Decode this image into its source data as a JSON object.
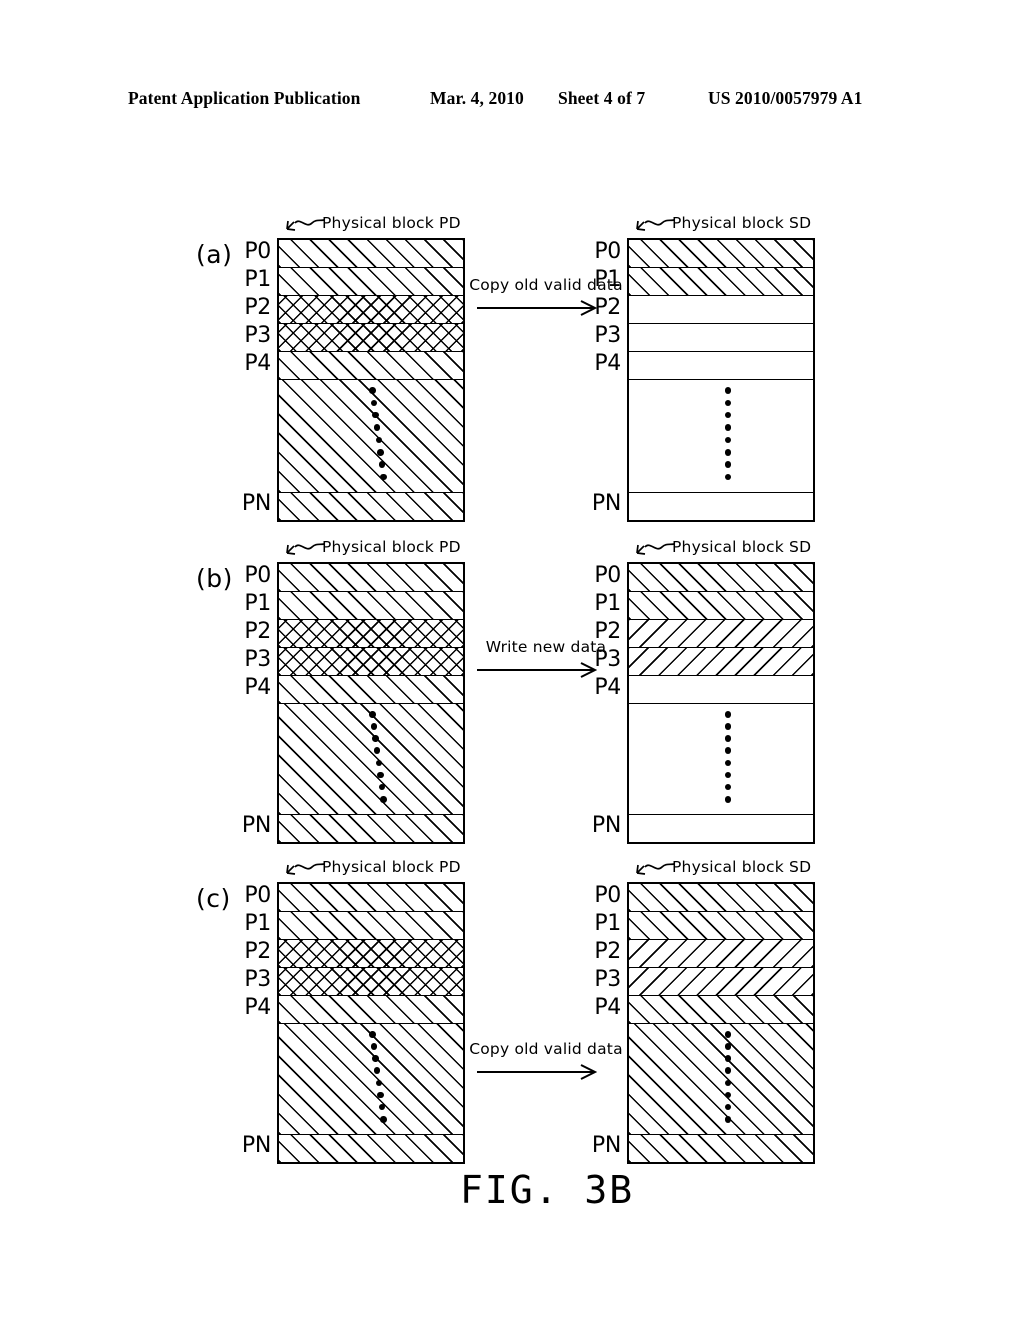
{
  "header": {
    "publication": "Patent Application Publication",
    "date": "Mar. 4, 2010",
    "sheet": "Sheet 4 of 7",
    "number": "US 2010/0057979 A1"
  },
  "figure": {
    "caption": "FIG. 3B",
    "row_labels": [
      "P0",
      "P1",
      "P2",
      "P3",
      "P4",
      "PN"
    ],
    "block_label_pd": "Physical block PD",
    "block_label_sd": "Physical block SD",
    "leader_icon": "squiggle-arrow-icon",
    "dot_count": 8,
    "groups": [
      {
        "id": "a",
        "label": "(a)",
        "transfer": {
          "text": "Copy old valid data",
          "arrow": "right-arrow-icon"
        },
        "source": {
          "name": "Physical block PD",
          "rows": {
            "P0": "diagonal-forward",
            "P1": "diagonal-forward",
            "P2": "cross-hatch",
            "P3": "cross-hatch",
            "P4": "diagonal-forward",
            "middle": "diagonal-forward",
            "PN": "diagonal-forward"
          }
        },
        "target": {
          "name": "Physical block SD",
          "rows": {
            "P0": "diagonal-forward",
            "P1": "diagonal-forward",
            "P2": "empty",
            "P3": "empty",
            "P4": "empty",
            "middle": "empty",
            "PN": "empty"
          }
        }
      },
      {
        "id": "b",
        "label": "(b)",
        "transfer": {
          "text": "Write new data",
          "arrow": "right-arrow-icon"
        },
        "source": {
          "name": "Physical block PD",
          "rows": {
            "P0": "diagonal-forward",
            "P1": "diagonal-forward",
            "P2": "cross-hatch",
            "P3": "cross-hatch",
            "P4": "diagonal-forward",
            "middle": "diagonal-forward",
            "PN": "diagonal-forward"
          }
        },
        "target": {
          "name": "Physical block SD",
          "rows": {
            "P0": "diagonal-forward",
            "P1": "diagonal-forward",
            "P2": "diagonal-backward",
            "P3": "diagonal-backward",
            "P4": "empty",
            "middle": "empty",
            "PN": "empty"
          }
        }
      },
      {
        "id": "c",
        "label": "(c)",
        "transfer": {
          "text": "Copy old valid data",
          "arrow": "right-arrow-icon"
        },
        "source": {
          "name": "Physical block PD",
          "rows": {
            "P0": "diagonal-forward",
            "P1": "diagonal-forward",
            "P2": "cross-hatch",
            "P3": "cross-hatch",
            "P4": "diagonal-forward",
            "middle": "diagonal-forward",
            "PN": "diagonal-forward"
          }
        },
        "target": {
          "name": "Physical block SD",
          "rows": {
            "P0": "diagonal-forward",
            "P1": "diagonal-forward",
            "P2": "diagonal-backward",
            "P3": "diagonal-backward",
            "P4": "diagonal-forward",
            "middle": "diagonal-forward",
            "PN": "diagonal-forward"
          }
        }
      }
    ]
  }
}
